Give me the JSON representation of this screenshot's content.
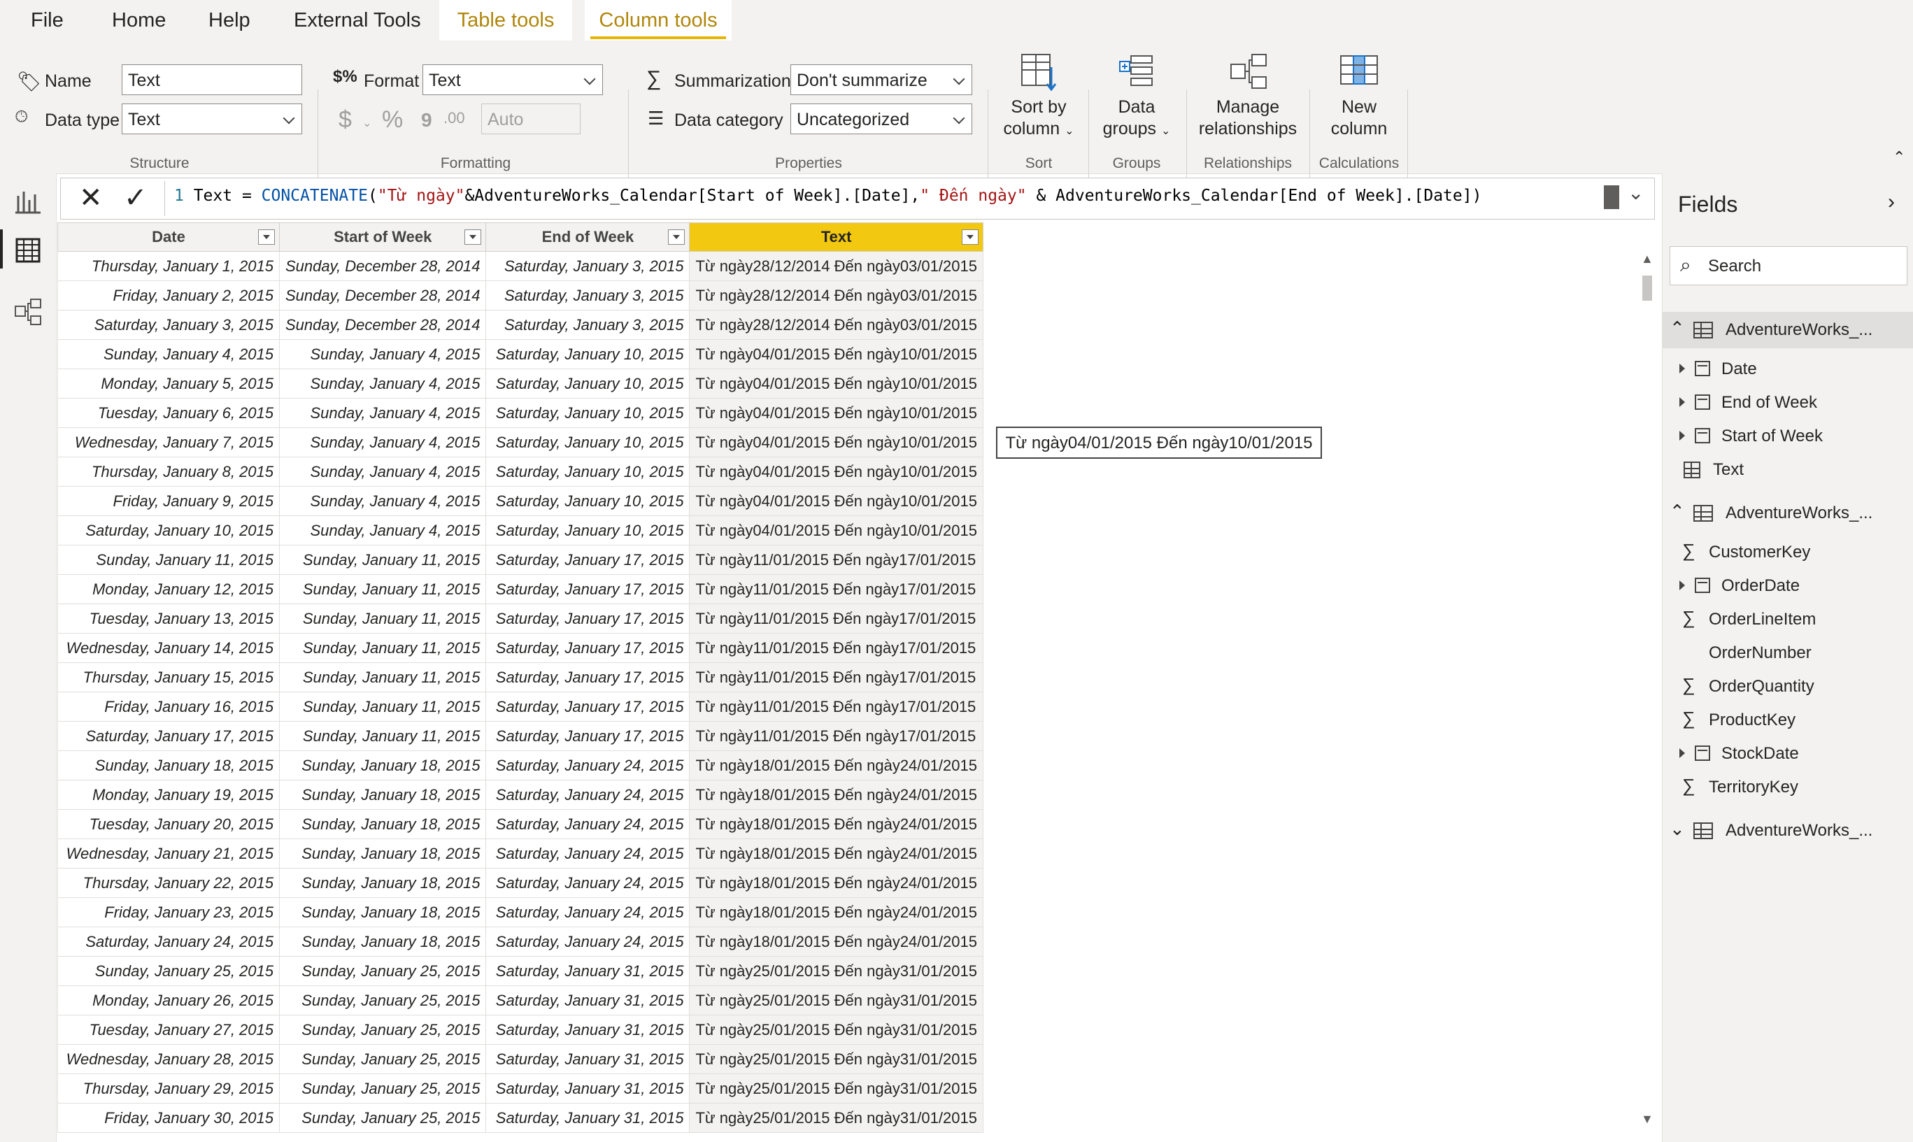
{
  "menu": {
    "items": [
      "File",
      "Home",
      "Help",
      "External Tools",
      "Table tools",
      "Column tools"
    ]
  },
  "ribbon": {
    "structure": {
      "name_label": "Name",
      "name_value": "Text",
      "datatype_label": "Data type",
      "datatype_value": "Text",
      "group_label": "Structure"
    },
    "formatting": {
      "format_label": "Format",
      "format_value": "Text",
      "currency_symbol": "$",
      "percent_symbol": "%",
      "comma_symbol": "9",
      "decimal_placeholder": "Auto",
      "group_label": "Formatting"
    },
    "properties": {
      "summarization_label": "Summarization",
      "summarization_value": "Don't summarize",
      "category_label": "Data category",
      "category_value": "Uncategorized",
      "group_label": "Properties"
    },
    "sort": {
      "btn_line1": "Sort by",
      "btn_line2": "column",
      "group_label": "Sort"
    },
    "groups": {
      "btn_line1": "Data",
      "btn_line2": "groups",
      "group_label": "Groups"
    },
    "relationships": {
      "btn_line1": "Manage",
      "btn_line2": "relationships",
      "group_label": "Relationships"
    },
    "calculations": {
      "btn_line1": "New",
      "btn_line2": "column",
      "group_label": "Calculations"
    }
  },
  "formula": {
    "line_number": "1",
    "text_plain1": " Text = ",
    "func": "CONCATENATE",
    "paren_open": "(",
    "str1": "\"Từ ngày\"",
    "mid1": "&AdventureWorks_Calendar[Start of Week].[Date],",
    "str2": "\" Đến ngày\"",
    "mid2": " & AdventureWorks_Calendar[End of Week].[Date])"
  },
  "table": {
    "columns": [
      "Date",
      "Start of Week",
      "End of Week",
      "Text"
    ],
    "rows": [
      [
        "Thursday, January 1, 2015",
        "Sunday, December 28, 2014",
        "Saturday, January 3, 2015",
        "Từ ngày28/12/2014 Đến ngày03/01/2015"
      ],
      [
        "Friday, January 2, 2015",
        "Sunday, December 28, 2014",
        "Saturday, January 3, 2015",
        "Từ ngày28/12/2014 Đến ngày03/01/2015"
      ],
      [
        "Saturday, January 3, 2015",
        "Sunday, December 28, 2014",
        "Saturday, January 3, 2015",
        "Từ ngày28/12/2014 Đến ngày03/01/2015"
      ],
      [
        "Sunday, January 4, 2015",
        "Sunday, January 4, 2015",
        "Saturday, January 10, 2015",
        "Từ ngày04/01/2015 Đến ngày10/01/2015"
      ],
      [
        "Monday, January 5, 2015",
        "Sunday, January 4, 2015",
        "Saturday, January 10, 2015",
        "Từ ngày04/01/2015 Đến ngày10/01/2015"
      ],
      [
        "Tuesday, January 6, 2015",
        "Sunday, January 4, 2015",
        "Saturday, January 10, 2015",
        "Từ ngày04/01/2015 Đến ngày10/01/2015"
      ],
      [
        "Wednesday, January 7, 2015",
        "Sunday, January 4, 2015",
        "Saturday, January 10, 2015",
        "Từ ngày04/01/2015 Đến ngày10/01/2015"
      ],
      [
        "Thursday, January 8, 2015",
        "Sunday, January 4, 2015",
        "Saturday, January 10, 2015",
        "Từ ngày04/01/2015 Đến ngày10/01/2015"
      ],
      [
        "Friday, January 9, 2015",
        "Sunday, January 4, 2015",
        "Saturday, January 10, 2015",
        "Từ ngày04/01/2015 Đến ngày10/01/2015"
      ],
      [
        "Saturday, January 10, 2015",
        "Sunday, January 4, 2015",
        "Saturday, January 10, 2015",
        "Từ ngày04/01/2015 Đến ngày10/01/2015"
      ],
      [
        "Sunday, January 11, 2015",
        "Sunday, January 11, 2015",
        "Saturday, January 17, 2015",
        "Từ ngày11/01/2015 Đến ngày17/01/2015"
      ],
      [
        "Monday, January 12, 2015",
        "Sunday, January 11, 2015",
        "Saturday, January 17, 2015",
        "Từ ngày11/01/2015 Đến ngày17/01/2015"
      ],
      [
        "Tuesday, January 13, 2015",
        "Sunday, January 11, 2015",
        "Saturday, January 17, 2015",
        "Từ ngày11/01/2015 Đến ngày17/01/2015"
      ],
      [
        "Wednesday, January 14, 2015",
        "Sunday, January 11, 2015",
        "Saturday, January 17, 2015",
        "Từ ngày11/01/2015 Đến ngày17/01/2015"
      ],
      [
        "Thursday, January 15, 2015",
        "Sunday, January 11, 2015",
        "Saturday, January 17, 2015",
        "Từ ngày11/01/2015 Đến ngày17/01/2015"
      ],
      [
        "Friday, January 16, 2015",
        "Sunday, January 11, 2015",
        "Saturday, January 17, 2015",
        "Từ ngày11/01/2015 Đến ngày17/01/2015"
      ],
      [
        "Saturday, January 17, 2015",
        "Sunday, January 11, 2015",
        "Saturday, January 17, 2015",
        "Từ ngày11/01/2015 Đến ngày17/01/2015"
      ],
      [
        "Sunday, January 18, 2015",
        "Sunday, January 18, 2015",
        "Saturday, January 24, 2015",
        "Từ ngày18/01/2015 Đến ngày24/01/2015"
      ],
      [
        "Monday, January 19, 2015",
        "Sunday, January 18, 2015",
        "Saturday, January 24, 2015",
        "Từ ngày18/01/2015 Đến ngày24/01/2015"
      ],
      [
        "Tuesday, January 20, 2015",
        "Sunday, January 18, 2015",
        "Saturday, January 24, 2015",
        "Từ ngày18/01/2015 Đến ngày24/01/2015"
      ],
      [
        "Wednesday, January 21, 2015",
        "Sunday, January 18, 2015",
        "Saturday, January 24, 2015",
        "Từ ngày18/01/2015 Đến ngày24/01/2015"
      ],
      [
        "Thursday, January 22, 2015",
        "Sunday, January 18, 2015",
        "Saturday, January 24, 2015",
        "Từ ngày18/01/2015 Đến ngày24/01/2015"
      ],
      [
        "Friday, January 23, 2015",
        "Sunday, January 18, 2015",
        "Saturday, January 24, 2015",
        "Từ ngày18/01/2015 Đến ngày24/01/2015"
      ],
      [
        "Saturday, January 24, 2015",
        "Sunday, January 18, 2015",
        "Saturday, January 24, 2015",
        "Từ ngày18/01/2015 Đến ngày24/01/2015"
      ],
      [
        "Sunday, January 25, 2015",
        "Sunday, January 25, 2015",
        "Saturday, January 31, 2015",
        "Từ ngày25/01/2015 Đến ngày31/01/2015"
      ],
      [
        "Monday, January 26, 2015",
        "Sunday, January 25, 2015",
        "Saturday, January 31, 2015",
        "Từ ngày25/01/2015 Đến ngày31/01/2015"
      ],
      [
        "Tuesday, January 27, 2015",
        "Sunday, January 25, 2015",
        "Saturday, January 31, 2015",
        "Từ ngày25/01/2015 Đến ngày31/01/2015"
      ],
      [
        "Wednesday, January 28, 2015",
        "Sunday, January 25, 2015",
        "Saturday, January 31, 2015",
        "Từ ngày25/01/2015 Đến ngày31/01/2015"
      ],
      [
        "Thursday, January 29, 2015",
        "Sunday, January 25, 2015",
        "Saturday, January 31, 2015",
        "Từ ngày25/01/2015 Đến ngày31/01/2015"
      ],
      [
        "Friday, January 30, 2015",
        "Sunday, January 25, 2015",
        "Saturday, January 31, 2015",
        "Từ ngày25/01/2015 Đến ngày31/01/2015"
      ]
    ]
  },
  "tooltip": "Từ ngày04/01/2015 Đến ngày10/01/2015",
  "fields": {
    "title": "Fields",
    "search_placeholder": "Search",
    "tables": [
      {
        "name": "AdventureWorks_...",
        "expanded": true,
        "fields": [
          {
            "name": "Date",
            "icon": "calendar-hierarchy"
          },
          {
            "name": "End of Week",
            "icon": "calendar-hierarchy"
          },
          {
            "name": "Start of Week",
            "icon": "calendar-hierarchy"
          },
          {
            "name": "Text",
            "icon": "calculated-column"
          }
        ]
      },
      {
        "name": "AdventureWorks_...",
        "expanded": true,
        "fields": [
          {
            "name": "CustomerKey",
            "icon": "sigma"
          },
          {
            "name": "OrderDate",
            "icon": "calendar-hierarchy"
          },
          {
            "name": "OrderLineItem",
            "icon": "sigma"
          },
          {
            "name": "OrderNumber",
            "icon": "none"
          },
          {
            "name": "OrderQuantity",
            "icon": "sigma"
          },
          {
            "name": "ProductKey",
            "icon": "sigma"
          },
          {
            "name": "StockDate",
            "icon": "calendar-hierarchy"
          },
          {
            "name": "TerritoryKey",
            "icon": "sigma"
          }
        ]
      },
      {
        "name": "AdventureWorks_...",
        "expanded": false,
        "fields": []
      }
    ]
  },
  "colors": {
    "accent": "#f2c811",
    "accent_text": "#b0860a",
    "string": "#a31515",
    "keyword": "#0451a5"
  }
}
